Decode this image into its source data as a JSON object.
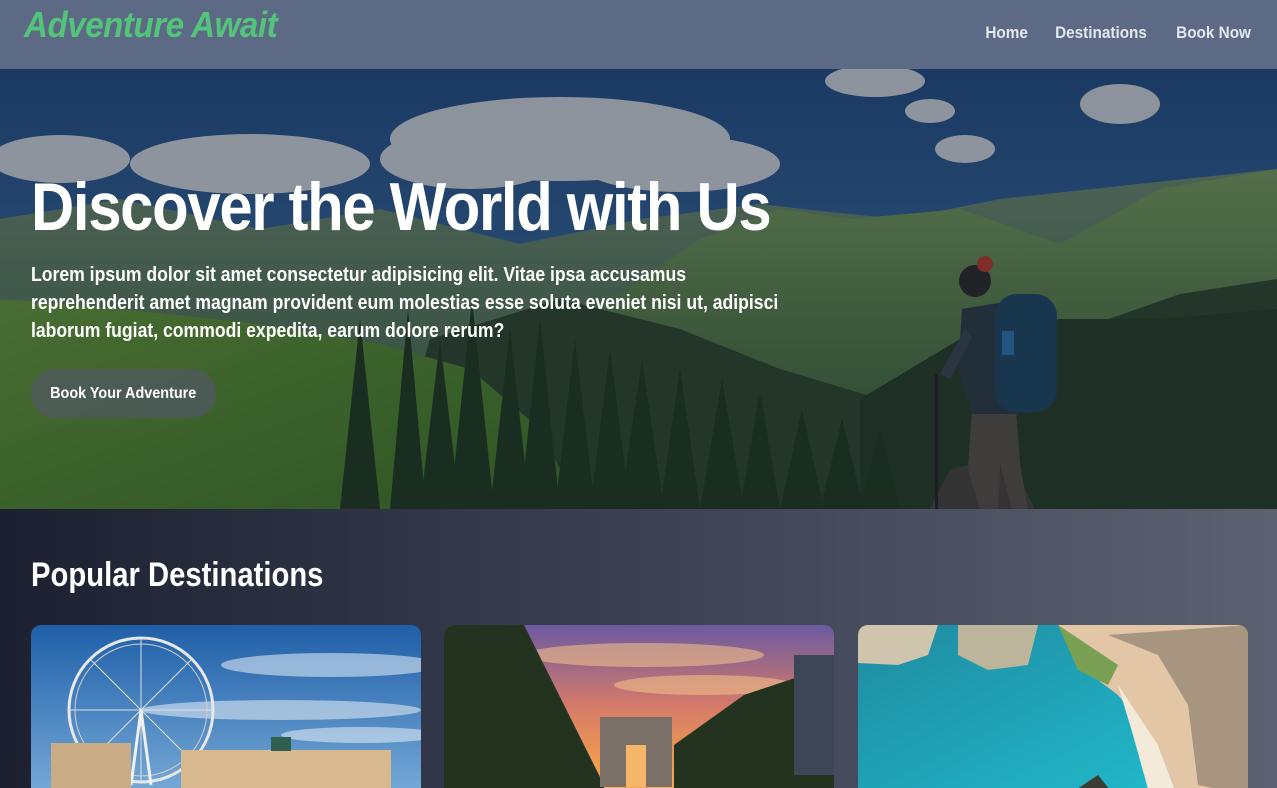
{
  "header": {
    "logo": "Adventure Await",
    "nav": [
      "Home",
      "Destinations",
      "Book Now"
    ]
  },
  "hero": {
    "title": "Discover the World with Us",
    "text": "Lorem ipsum dolor sit amet consectetur adipisicing elit. Vitae ipsa accusamus reprehenderit amet magnam provident eum molestias esse soluta eveniet nisi ut, adipisci laborum fugiat, commodi expedita, earum dolore rerum?",
    "button": "Book Your Adventure"
  },
  "destinations": {
    "title": "Popular Destinations"
  },
  "colors": {
    "header_bg": "#5d6a85",
    "logo": "#53c57a",
    "nav_text": "#e4e8ef"
  }
}
